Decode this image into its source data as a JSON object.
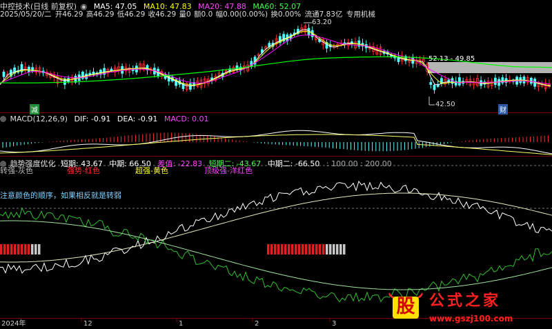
{
  "header": {
    "title": "中控技术(日线 前复权)",
    "ma5": "MA5: 47.05",
    "ma10": "MA10: 47.83",
    "ma20": "MA20: 47.88",
    "ma60": "MA60: 52.07"
  },
  "quote": {
    "date": "2025/05/20/二",
    "open": "开46.29",
    "high": "高46.29",
    "low": "低46.29",
    "close": "收46.29",
    "volume": "量0",
    "amount": "额0.0",
    "change": "幅0.00(0.00%)",
    "turnover": "换0.00%",
    "float": "流通7.83亿",
    "sector": "专用机械"
  },
  "price_panel": {
    "high_label": "63.20",
    "range_label": "52.13 - 49.85",
    "low_label": "42.50",
    "marker_green": "减",
    "marker_blue": "财"
  },
  "macd": {
    "title": "MACD(12,26,9)",
    "dif": "DIF: -0.91",
    "dea": "DEA: -0.91",
    "macd": "MACD: 0.01"
  },
  "trend": {
    "title": "趋势强度优化",
    "short": "短期: 43.67",
    "mid": "中期: 66.50",
    "diff": "差值: -22.83",
    "short2": "短期二: -43.67",
    "mid2": "中期二: -66.50",
    "levels": ": 100.00 : 200.00",
    "legend_gray": "转强-灰色",
    "legend_red": "强势-红色",
    "legend_yellow": "超强-黄色",
    "legend_magenta": "顶级强-洋红色",
    "note": "注意颜色的顺序，如果相反就是转弱"
  },
  "time_axis": {
    "labels": [
      "2024年",
      "12",
      "1",
      "2",
      "3"
    ]
  },
  "watermark": {
    "logo": "股",
    "name": "公式之家",
    "url": "www.gszj100.com"
  },
  "colors": {
    "ma5": "#ffffff",
    "ma10": "#ffff00",
    "ma20": "#ff00ff",
    "ma60": "#00ff00",
    "up": "#ff3030",
    "down": "#54ffff",
    "grid": "#800000"
  }
}
